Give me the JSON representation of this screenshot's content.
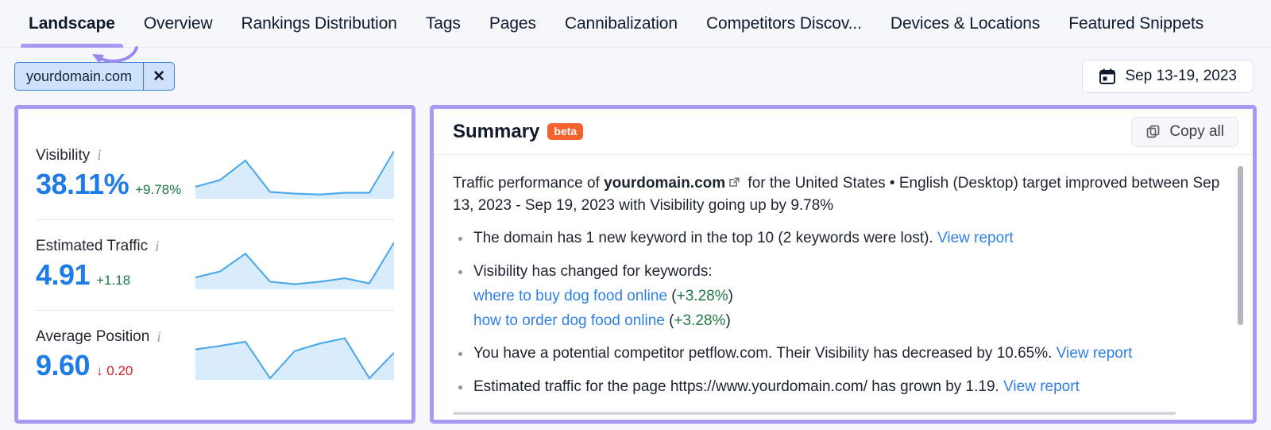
{
  "tabs": [
    {
      "label": "Landscape",
      "active": true
    },
    {
      "label": "Overview",
      "active": false
    },
    {
      "label": "Rankings Distribution",
      "active": false
    },
    {
      "label": "Tags",
      "active": false
    },
    {
      "label": "Pages",
      "active": false
    },
    {
      "label": "Cannibalization",
      "active": false
    },
    {
      "label": "Competitors Discov...",
      "active": false
    },
    {
      "label": "Devices & Locations",
      "active": false
    },
    {
      "label": "Featured Snippets",
      "active": false
    }
  ],
  "filters": {
    "domain_chip": {
      "label": "yourdomain.com",
      "close_icon": "close-icon",
      "close_glyph": "✕"
    },
    "date_range": {
      "label": "Sep 13-19, 2023",
      "icon": "calendar-icon"
    }
  },
  "metrics": [
    {
      "name": "Visibility",
      "info_icon": "info-icon",
      "value": "38.11%",
      "delta": "+9.78%",
      "direction": "up",
      "spark": [
        34,
        28,
        10,
        40,
        42,
        43,
        41,
        41,
        2
      ]
    },
    {
      "name": "Estimated Traffic",
      "info_icon": "info-icon",
      "value": "4.91",
      "delta": "+1.18",
      "direction": "down_none",
      "spark": [
        34,
        27,
        12,
        40,
        43,
        41,
        37,
        41,
        3
      ]
    },
    {
      "name": "Average Position",
      "info_icon": "info-icon",
      "value": "9.60",
      "delta": "↓ 0.20",
      "direction": "down",
      "spark": [
        17,
        13,
        10,
        52,
        18,
        12,
        8,
        52,
        22
      ]
    }
  ],
  "summary": {
    "title": "Summary",
    "badge": "beta",
    "copy_label": "Copy all",
    "copy_icon": "copy-icon",
    "intro": {
      "pre": "Traffic performance of ",
      "domain": "yourdomain.com",
      "external_icon": "external-link-icon",
      "post": " for the United States • English (Desktop) target improved between Sep 13, 2023 - Sep 19, 2023 with Visibility going up by 9.78%"
    },
    "bullets": [
      {
        "text": "The domain has 1 new keyword in the top 10 (2 keywords were lost). ",
        "link": "View report"
      },
      {
        "text": "Visibility has changed for keywords:",
        "keywords": [
          {
            "term": "where to buy dog food online",
            "change": "+3.28%"
          },
          {
            "term": "how to order dog food online",
            "change": "+3.28%"
          }
        ]
      },
      {
        "text": "You have a potential competitor petflow.com. Their Visibility has decreased by 10.65%. ",
        "link": "View report"
      },
      {
        "text": "Estimated traffic for the page https://www.yourdomain.com/ has grown by 1.19. ",
        "link": "View report"
      }
    ]
  },
  "colors": {
    "highlight_border": "#a899f5",
    "accent_blue": "#1f7be5",
    "link_blue": "#2f7fe8",
    "positive_green": "#1e7a43",
    "negative_red": "#e02020",
    "beta_orange": "#f4622e",
    "spark_line": "#49a8ec",
    "spark_fill": "#d9ecfb",
    "chip_bg": "#cfe2fb",
    "chip_border": "#3b7fd4",
    "page_bg": "#f5f7fa"
  }
}
